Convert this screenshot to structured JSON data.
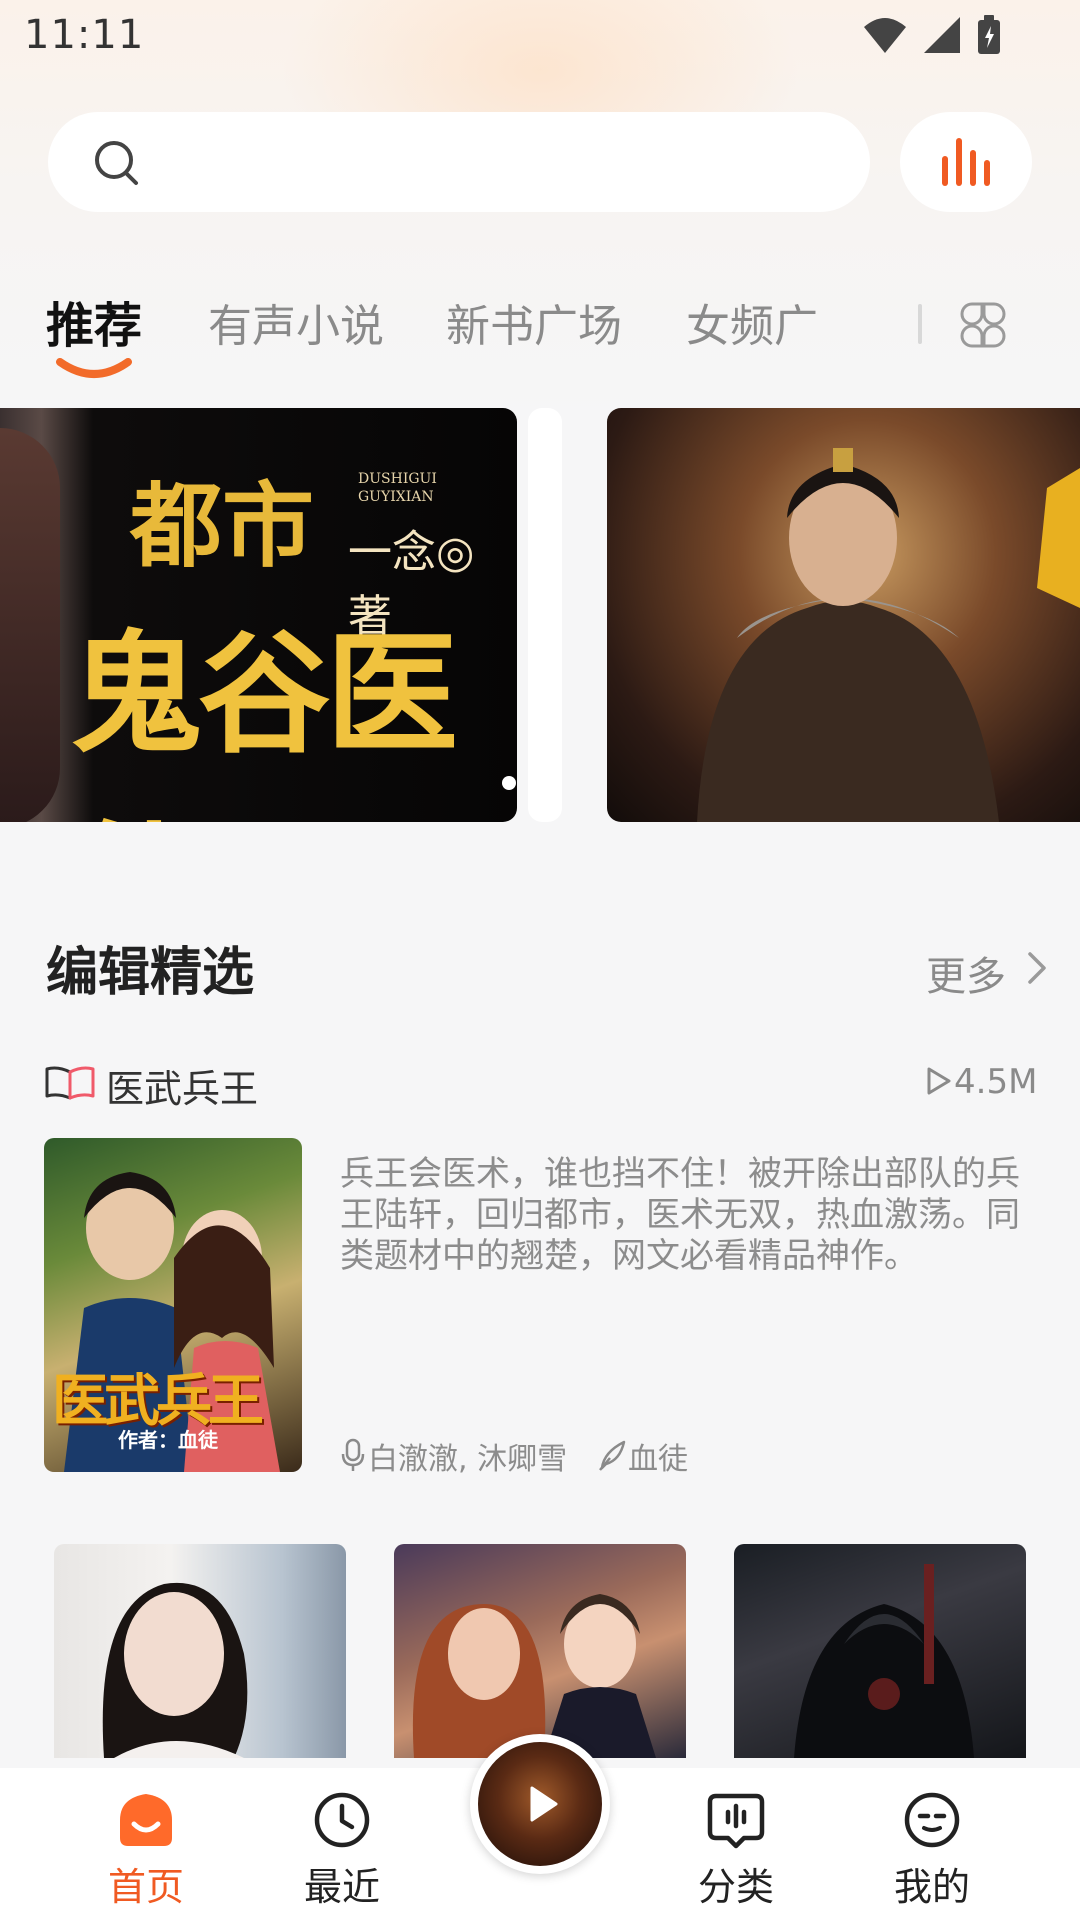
{
  "status_bar": {
    "time": "11:11"
  },
  "search": {
    "placeholder": ""
  },
  "tabs": [
    {
      "label": "推荐",
      "active": true
    },
    {
      "label": "有声小说",
      "active": false
    },
    {
      "label": "新书广场",
      "active": false
    },
    {
      "label": "女频广",
      "active": false
    }
  ],
  "banners": [
    {
      "title_line1": "都市",
      "title_line2": "鬼谷医仙",
      "author": "一念◎著",
      "pinyin_line1": "DUSHIGUI",
      "pinyin_line2": "GUYIXIAN"
    },
    {
      "image": "armored-warrior-cover"
    }
  ],
  "section": {
    "title": "编辑精选",
    "more_label": "更多"
  },
  "featured": {
    "title": "医武兵王",
    "plays": "4.5M",
    "cover_title": "医武兵王",
    "cover_author": "作者：血徒",
    "description": "兵王会医术，谁也挡不住！被开除出部队的兵王陆轩，回归都市，医术无双，热血激荡。同类题材中的翘楚，网文必看精品神作。",
    "narrators": "白澈澈, 沐卿雪",
    "author": "血徒"
  },
  "grid_books": [
    {
      "image": "woman-portrait-cover"
    },
    {
      "image": "couple-cover"
    },
    {
      "image": "dark-warrior-cover"
    }
  ],
  "bottom_nav": [
    {
      "label": "首页",
      "icon": "home-icon",
      "active": true
    },
    {
      "label": "最近",
      "icon": "clock-icon",
      "active": false
    },
    {
      "label": "分类",
      "icon": "category-icon",
      "active": false
    },
    {
      "label": "我的",
      "icon": "profile-icon",
      "active": false
    }
  ],
  "colors": {
    "accent": "#f05a22",
    "accent_light": "#ff8a3c"
  }
}
